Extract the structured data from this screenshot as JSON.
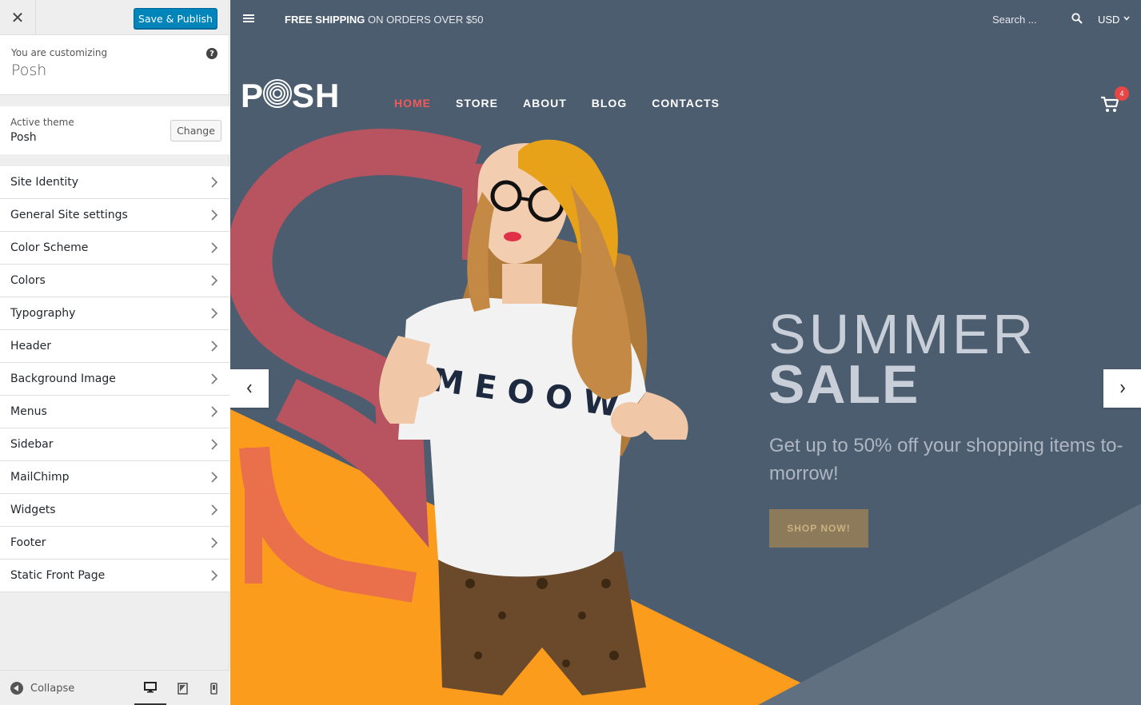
{
  "customizer": {
    "save_label": "Save & Publish",
    "customizing_label": "You are customizing",
    "site_name": "Posh",
    "active_theme_label": "Active theme",
    "active_theme_name": "Posh",
    "change_label": "Change",
    "menu": [
      {
        "label": "Site Identity"
      },
      {
        "label": "General Site settings"
      },
      {
        "label": "Color Scheme"
      },
      {
        "label": "Colors"
      },
      {
        "label": "Typography"
      },
      {
        "label": "Header"
      },
      {
        "label": "Background Image"
      },
      {
        "label": "Menus"
      },
      {
        "label": "Sidebar"
      },
      {
        "label": "MailChimp"
      },
      {
        "label": "Widgets"
      },
      {
        "label": "Footer"
      },
      {
        "label": "Static Front Page"
      }
    ],
    "collapse_label": "Collapse",
    "devices": [
      "desktop-icon",
      "tablet-icon",
      "mobile-icon"
    ],
    "active_device": "desktop"
  },
  "site": {
    "shipping_bold": "FREE SHIPPING",
    "shipping_rest": " ON ORDERS OVER $50",
    "search_placeholder": "Search ...",
    "currency": "USD",
    "logo": "POSH",
    "nav": [
      {
        "label": "HOME",
        "active": true
      },
      {
        "label": "STORE",
        "active": false
      },
      {
        "label": "ABOUT",
        "active": false
      },
      {
        "label": "BLOG",
        "active": false
      },
      {
        "label": "CONTACTS",
        "active": false
      }
    ],
    "cart_count": "4",
    "hero": {
      "shirt_text": "MEOOW",
      "title_line1": "SUMMER",
      "title_line2": "SALE",
      "subtitle": "Get up to 50% off your shopping items to-morrow!",
      "button": "SHOP NOW!"
    }
  },
  "colors": {
    "accent_blue": "#0085ba",
    "hero_bg": "#4d5d70",
    "nav_active": "#f05a5a",
    "orange": "#fb9c1c",
    "button_brown": "#8c7a5a"
  }
}
